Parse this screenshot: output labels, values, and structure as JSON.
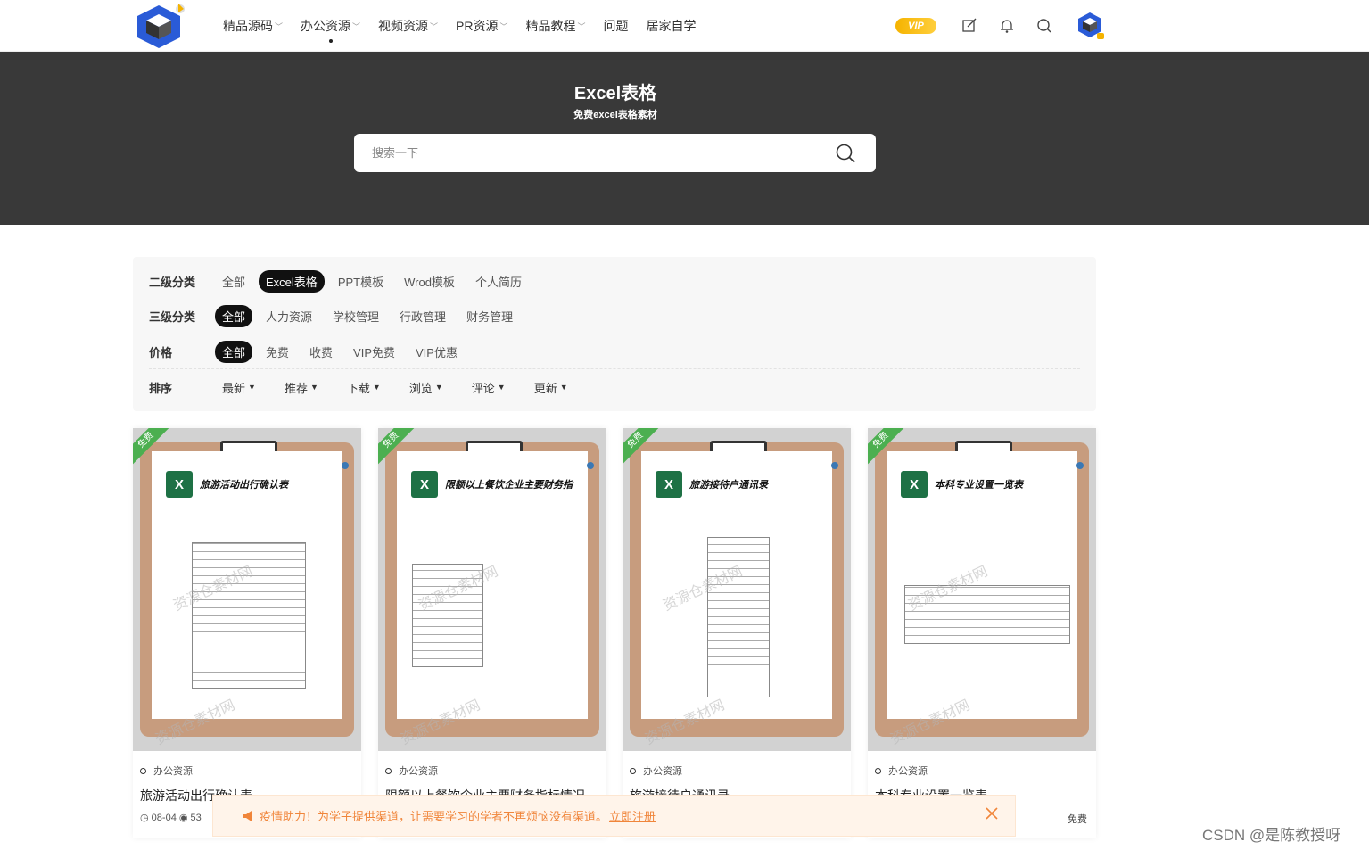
{
  "nav": {
    "items": [
      {
        "label": "精品源码",
        "dropdown": true
      },
      {
        "label": "办公资源",
        "dropdown": true,
        "active": true
      },
      {
        "label": "视频资源",
        "dropdown": true
      },
      {
        "label": "PR资源",
        "dropdown": true
      },
      {
        "label": "精品教程",
        "dropdown": true
      },
      {
        "label": "问题",
        "dropdown": false
      },
      {
        "label": "居家自学",
        "dropdown": false
      }
    ],
    "vip_label": "VIP"
  },
  "hero": {
    "title": "Excel表格",
    "subtitle": "免费excel表格素材",
    "search_placeholder": "搜索一下"
  },
  "filters": {
    "secondary": {
      "label": "二级分类",
      "options": [
        "全部",
        "Excel表格",
        "PPT模板",
        "Wrod模板",
        "个人简历"
      ],
      "active": 1
    },
    "tertiary": {
      "label": "三级分类",
      "options": [
        "全部",
        "人力资源",
        "学校管理",
        "行政管理",
        "财务管理"
      ],
      "active": 0
    },
    "price": {
      "label": "价格",
      "options": [
        "全部",
        "免费",
        "收费",
        "VIP免费",
        "VIP优惠"
      ],
      "active": 0
    },
    "sort": {
      "label": "排序",
      "options": [
        "最新",
        "推荐",
        "下载",
        "浏览",
        "评论",
        "更新"
      ]
    }
  },
  "cards": [
    {
      "ribbon": "免费",
      "doc_title": "旅游活动出行确认表",
      "category": "办公资源",
      "title": "旅游活动出行确认表",
      "date": "08-04",
      "views": "53",
      "price": ""
    },
    {
      "ribbon": "免费",
      "doc_title": "限额以上餐饮企业主要财务指",
      "category": "办公资源",
      "title": "限额以上餐饮企业主要财务指标情况",
      "date": "",
      "views": "",
      "price": ""
    },
    {
      "ribbon": "免费",
      "doc_title": "旅游接待户通讯录",
      "category": "办公资源",
      "title": "旅游接待户通讯录",
      "date": "",
      "views": "",
      "price": ""
    },
    {
      "ribbon": "免费",
      "doc_title": "本科专业设置一览表",
      "category": "办公资源",
      "title": "本科专业设置一览表",
      "date": "",
      "views": "",
      "price": "免费"
    }
  ],
  "watermark": "资源仓素材网",
  "notice": {
    "text": "疫情助力！为学子提供渠道，让需要学习的学者不再烦恼没有渠道。",
    "link": "立即注册"
  },
  "footer_watermark": "CSDN @是陈教授呀",
  "colors": {
    "accent": "#111111",
    "hero_bg": "#393939",
    "free_ribbon": "#4caf50",
    "notice": "#f0853a",
    "excel": "#1e7145"
  }
}
